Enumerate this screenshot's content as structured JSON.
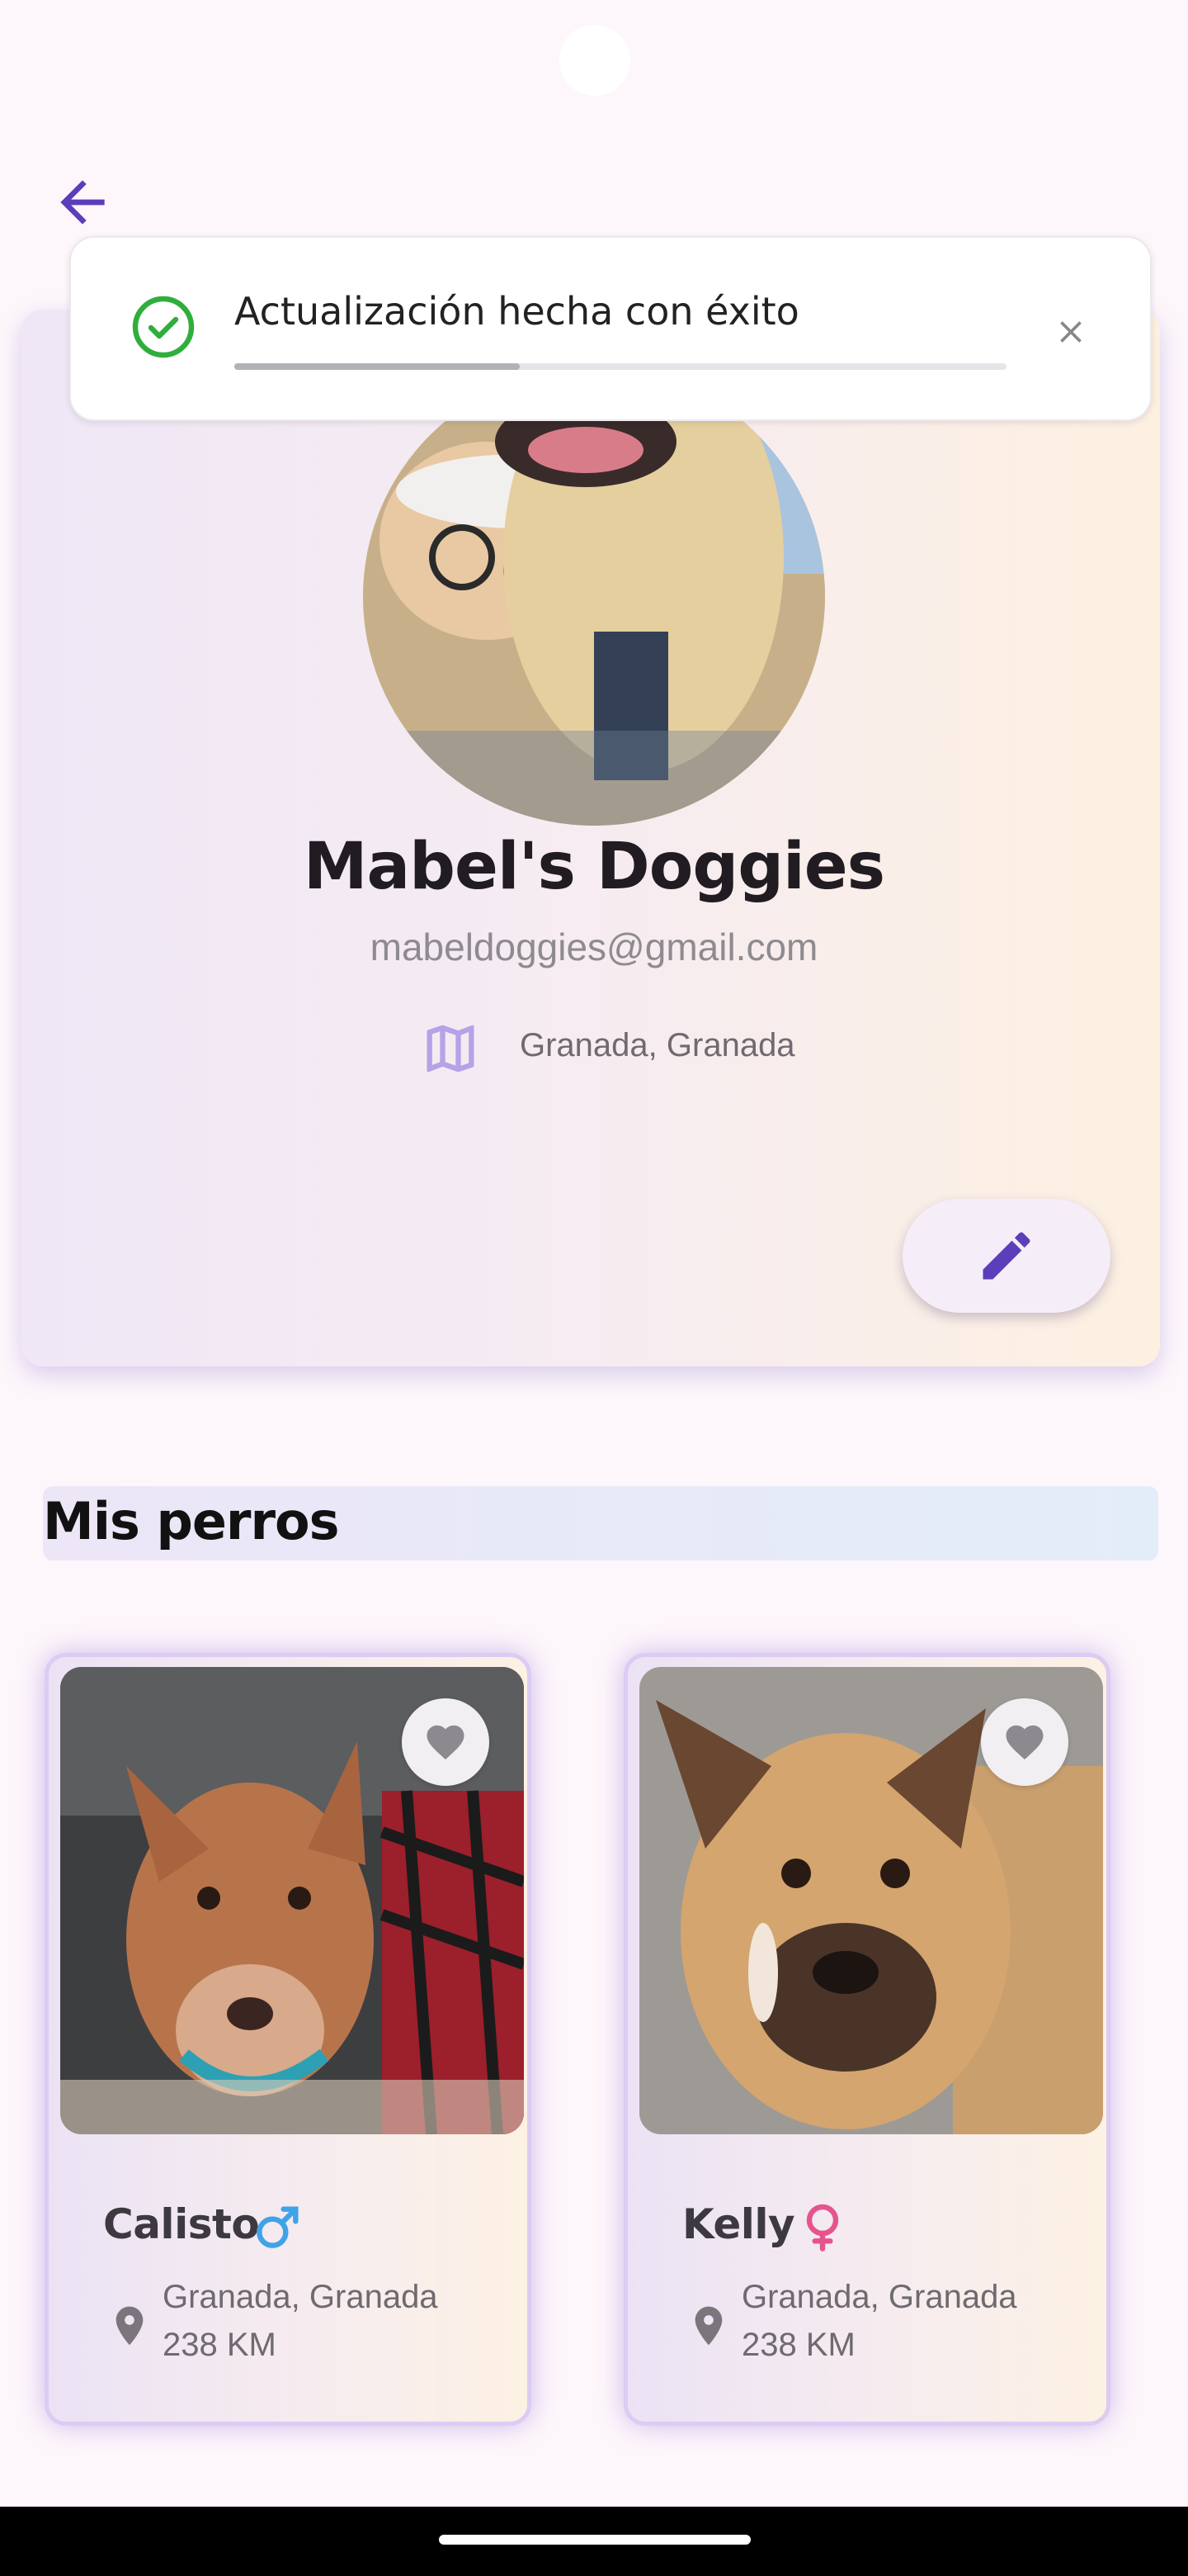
{
  "toast": {
    "message": "Actualización hecha con éxito",
    "progress": 0.37,
    "success_color": "#2fae3c"
  },
  "profile": {
    "name": "Mabel's Doggies",
    "email": "mabeldoggies@gmail.com",
    "location": "Granada, Granada"
  },
  "section": {
    "title": "Mis perros"
  },
  "dogs": [
    {
      "name": "Calisto",
      "gender": "male",
      "gender_color": "#3fa3e8",
      "location": "Granada, Granada",
      "distance": "238 KM"
    },
    {
      "name": "Kelly",
      "gender": "female",
      "gender_color": "#e5548f",
      "location": "Granada, Granada",
      "distance": "238 KM"
    }
  ],
  "colors": {
    "accent": "#5c3eba",
    "map_icon": "#b6a2e6"
  },
  "icons": {
    "back": "arrow-left-icon",
    "map": "map-icon",
    "edit": "pencil-icon",
    "favorite": "heart-icon",
    "location": "location-pin-icon",
    "success": "check-circle-icon",
    "close": "close-icon"
  }
}
